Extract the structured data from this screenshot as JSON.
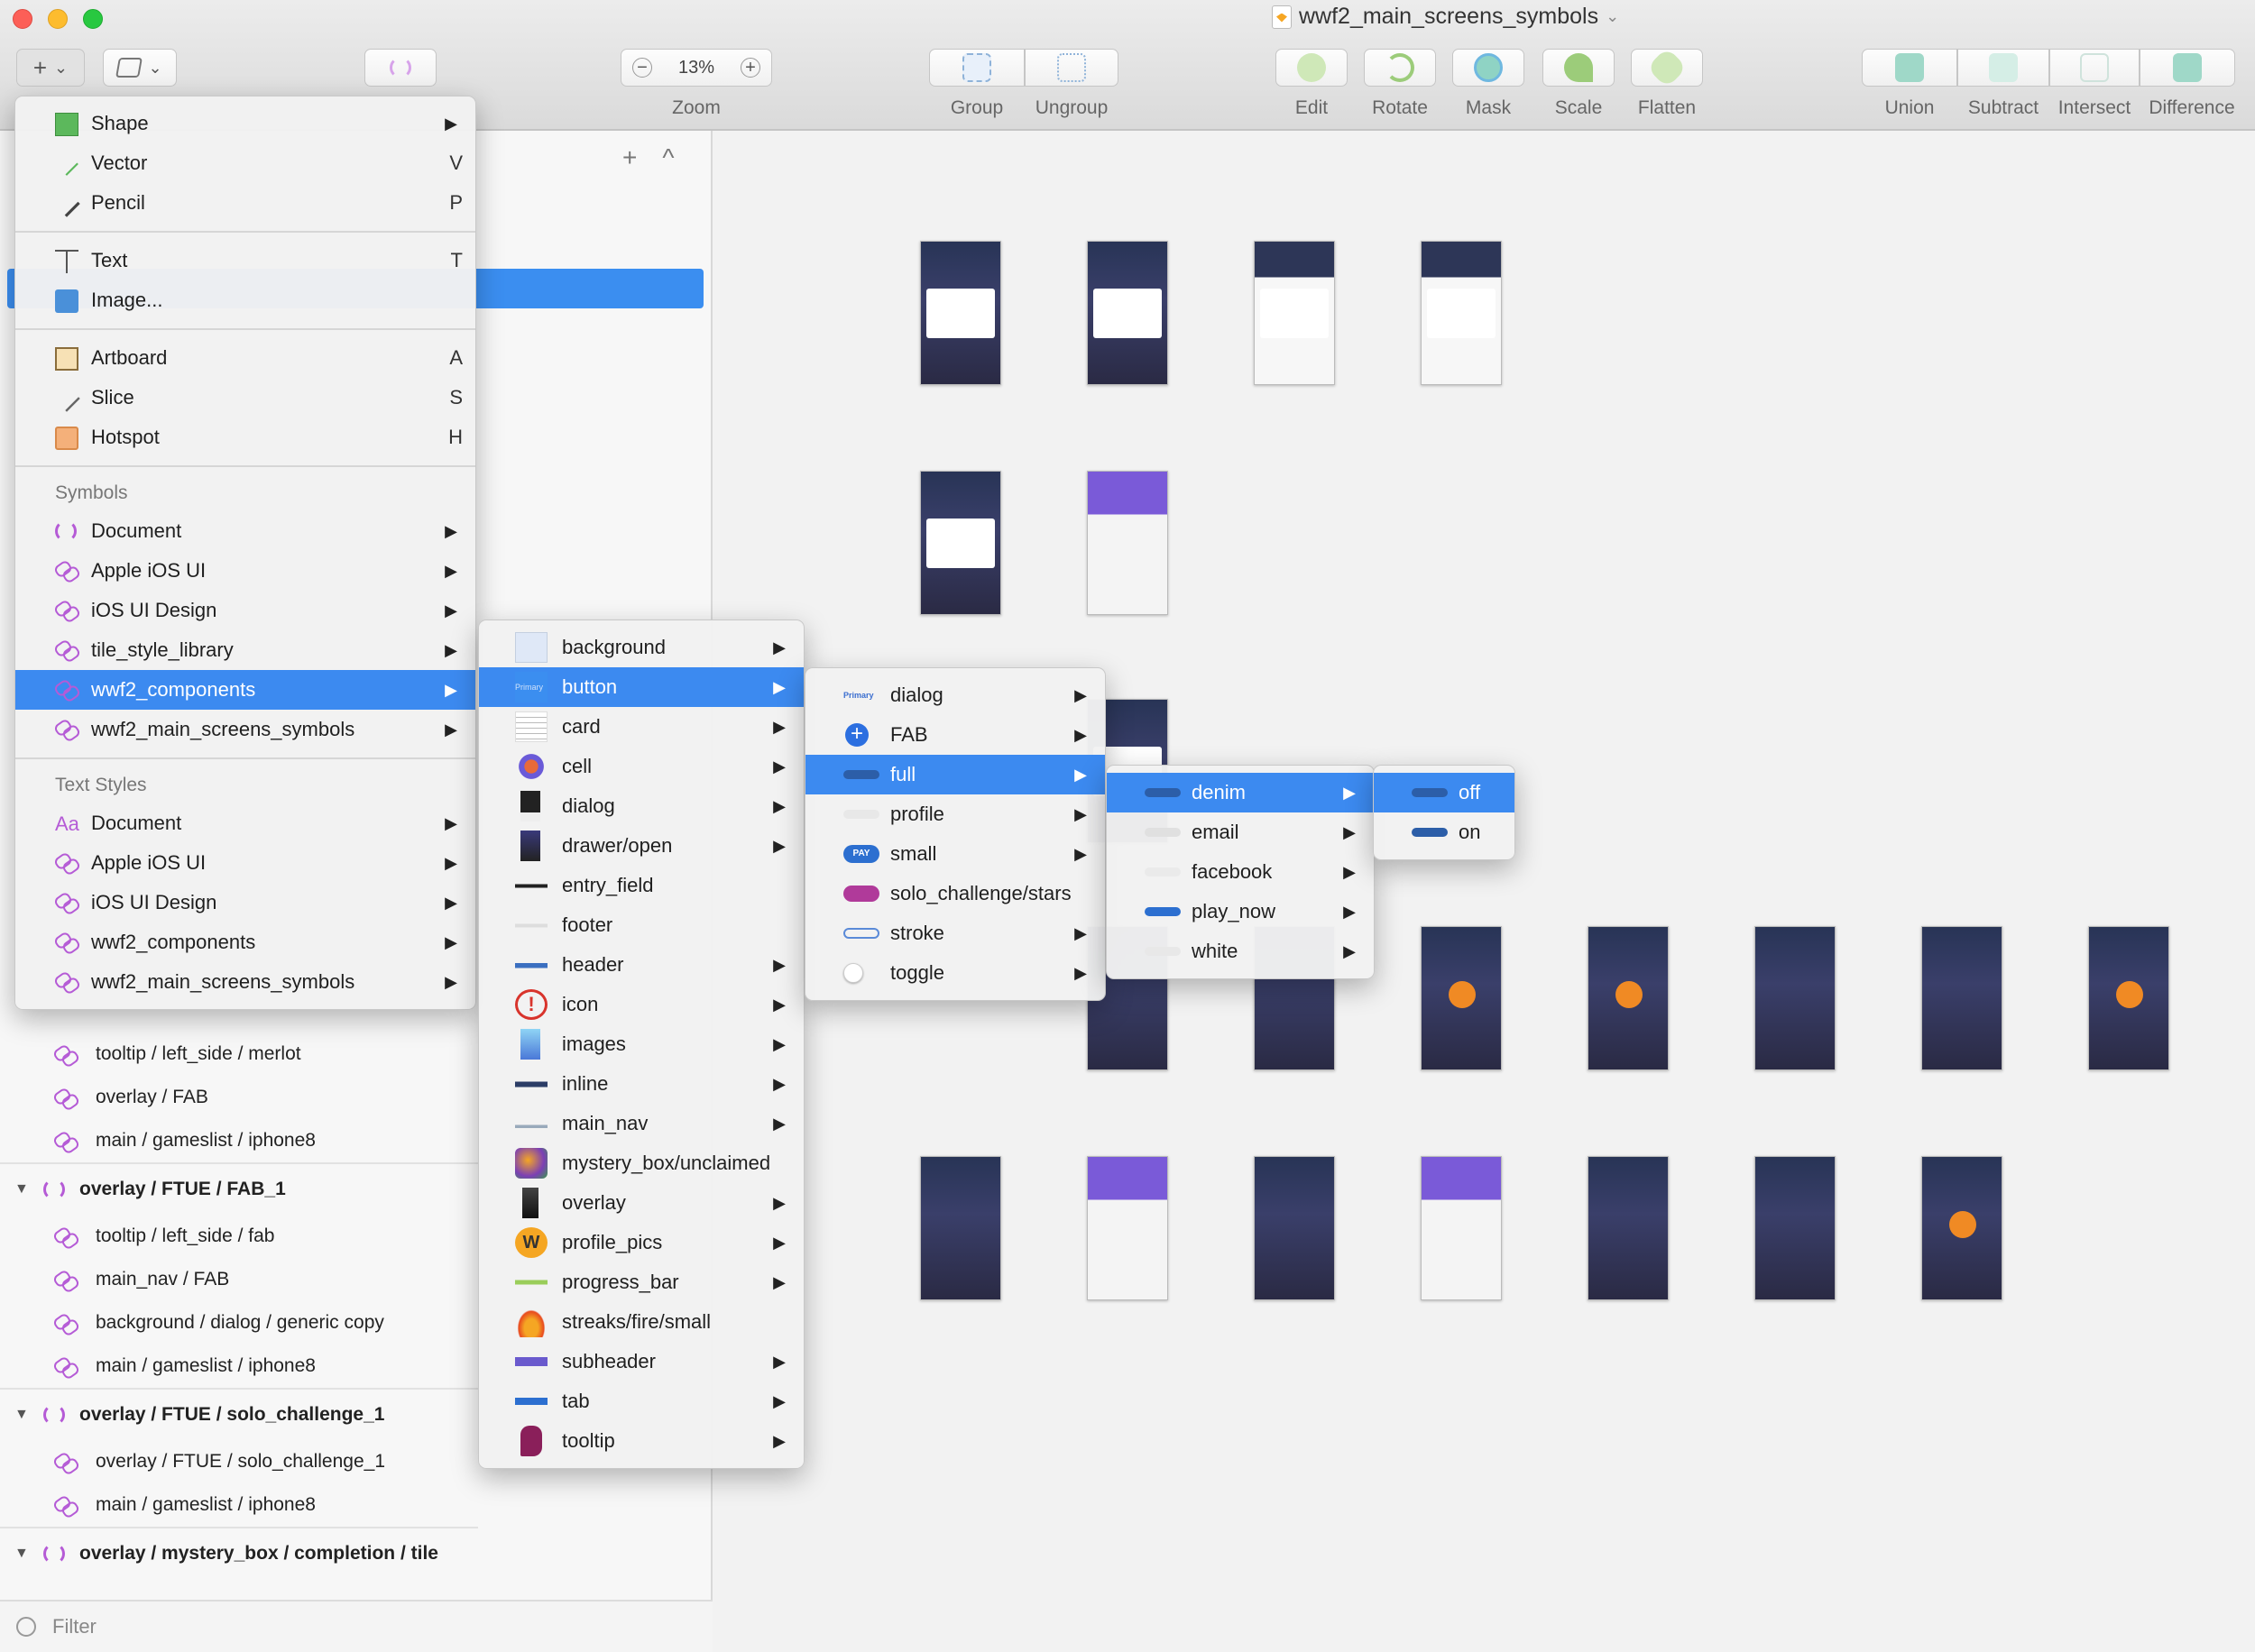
{
  "window": {
    "title": "wwf2_main_screens_symbols",
    "title_chevron": "⌄"
  },
  "toolbar": {
    "insert_glyph": "+",
    "insert_chevron": "⌄",
    "layers_chevron": "⌄",
    "zoom_minus": "−",
    "zoom_value": "13%",
    "zoom_plus": "+",
    "zoom_label": "Zoom",
    "group_label": "Group",
    "ungroup_label": "Ungroup",
    "edit_label": "Edit",
    "rotate_label": "Rotate",
    "mask_label": "Mask",
    "scale_label": "Scale",
    "flatten_label": "Flatten",
    "union_label": "Union",
    "subtract_label": "Subtract",
    "intersect_label": "Intersect",
    "difference_label": "Difference"
  },
  "layers_panel": {
    "add_glyph": "+",
    "collapse_glyph": "^",
    "rows": [
      {
        "kind": "child",
        "label": "tooltip / left_side / merlot"
      },
      {
        "kind": "child",
        "label": "overlay / FAB"
      },
      {
        "kind": "child",
        "label": "main / gameslist / iphone8"
      },
      {
        "kind": "group",
        "label": "overlay / FTUE / FAB_1"
      },
      {
        "kind": "child",
        "label": "tooltip / left_side / fab"
      },
      {
        "kind": "child",
        "label": "main_nav / FAB"
      },
      {
        "kind": "child",
        "label": "background / dialog / generic copy"
      },
      {
        "kind": "child",
        "label": "main / gameslist / iphone8"
      },
      {
        "kind": "group",
        "label": "overlay / FTUE / solo_challenge_1"
      },
      {
        "kind": "child",
        "label": "overlay / FTUE / solo_challenge_1"
      },
      {
        "kind": "child",
        "label": "main / gameslist / iphone8"
      },
      {
        "kind": "group",
        "label": "overlay / mystery_box / completion / tile"
      }
    ],
    "filter_placeholder": "Filter"
  },
  "insert_menu": {
    "items": [
      {
        "label": "Shape",
        "key": "▶",
        "icon": "shape-icon"
      },
      {
        "label": "Vector",
        "key": "V",
        "icon": "vector-pen-icon"
      },
      {
        "label": "Pencil",
        "key": "P",
        "icon": "pencil-icon"
      },
      {
        "label": "Text",
        "key": "T",
        "icon": "text-icon"
      },
      {
        "label": "Image...",
        "key": "",
        "icon": "image-icon"
      },
      {
        "label": "Artboard",
        "key": "A",
        "icon": "artboard-icon"
      },
      {
        "label": "Slice",
        "key": "S",
        "icon": "slice-icon"
      },
      {
        "label": "Hotspot",
        "key": "H",
        "icon": "hotspot-icon"
      }
    ],
    "symbols_header": "Symbols",
    "symbols": [
      {
        "label": "Document"
      },
      {
        "label": "Apple iOS UI"
      },
      {
        "label": "iOS UI Design"
      },
      {
        "label": "tile_style_library"
      },
      {
        "label": "wwf2_components"
      },
      {
        "label": "wwf2_main_screens_symbols"
      }
    ],
    "text_styles_header": "Text Styles",
    "text_styles": [
      {
        "label": "Document",
        "icon_text": "Aa"
      },
      {
        "label": "Apple iOS UI"
      },
      {
        "label": "iOS UI Design"
      },
      {
        "label": "wwf2_components"
      },
      {
        "label": "wwf2_main_screens_symbols"
      }
    ]
  },
  "components_menu": {
    "items": [
      {
        "label": "background"
      },
      {
        "label": "button",
        "icon_text": "Primary"
      },
      {
        "label": "card"
      },
      {
        "label": "cell"
      },
      {
        "label": "dialog"
      },
      {
        "label": "drawer/open"
      },
      {
        "label": "entry_field"
      },
      {
        "label": "footer"
      },
      {
        "label": "header"
      },
      {
        "label": "icon",
        "icon_text": "!"
      },
      {
        "label": "images"
      },
      {
        "label": "inline"
      },
      {
        "label": "main_nav"
      },
      {
        "label": "mystery_box/unclaimed"
      },
      {
        "label": "overlay"
      },
      {
        "label": "profile_pics",
        "icon_text": "W"
      },
      {
        "label": "progress_bar"
      },
      {
        "label": "streaks/fire/small"
      },
      {
        "label": "subheader"
      },
      {
        "label": "tab"
      },
      {
        "label": "tooltip"
      }
    ]
  },
  "button_menu": {
    "items": [
      {
        "label": "dialog",
        "icon_text": "Primary"
      },
      {
        "label": "FAB",
        "icon_text": "+"
      },
      {
        "label": "full"
      },
      {
        "label": "profile"
      },
      {
        "label": "small",
        "icon_text": "PAY"
      },
      {
        "label": "solo_challenge/stars"
      },
      {
        "label": "stroke"
      },
      {
        "label": "toggle"
      }
    ]
  },
  "full_menu": {
    "items": [
      {
        "label": "denim"
      },
      {
        "label": "email"
      },
      {
        "label": "facebook"
      },
      {
        "label": "play_now"
      },
      {
        "label": "white"
      }
    ]
  },
  "denim_menu": {
    "items": [
      {
        "label": "off"
      },
      {
        "label": "on"
      }
    ]
  },
  "colors": {
    "accent": "#3c8af0",
    "symbol_purple": "#b55bd6",
    "shape_green": "#5cb85c",
    "hotspot_orange": "#f4b07a"
  },
  "arrow_glyph": "▶"
}
